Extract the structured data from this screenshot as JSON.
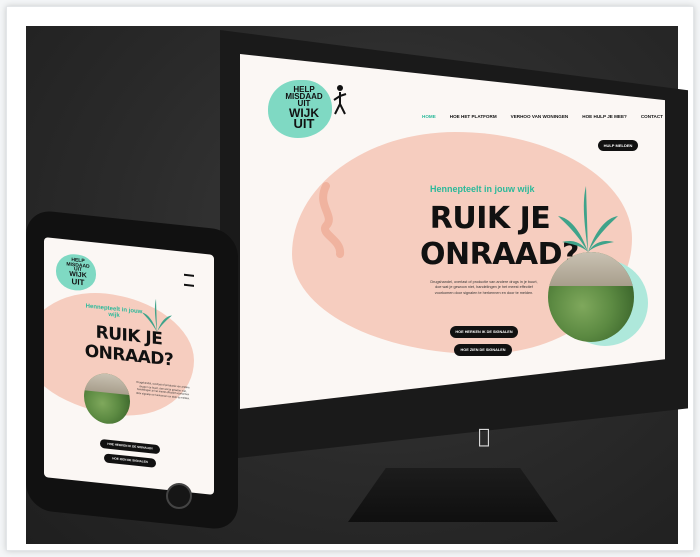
{
  "site": {
    "logo_lines": [
      "HELP",
      "MISDAAD",
      "UIT",
      "WIJK",
      "UIT"
    ],
    "nav": [
      "Home",
      "Hoe het platform",
      "Verhoo van woningen",
      "Hoe hulp je mee?",
      "Contact"
    ],
    "nav_button": "Hulp melden",
    "eyebrow": "Hennepteelt in jouw wijk",
    "headline_1": "RUIK JE",
    "headline_2": "ONRAAD?",
    "body": "Drugshandel, overlast of productie van andere drugs in je buurt, doe wat je gewoon niet, handelingen je het meest effectief voorkomen door signalen te herkennen en door te melden.",
    "button_primary": "Hoe herken ik de signalen",
    "button_secondary": "Hoe zien de signalen",
    "colors": {
      "teal": "#7fd9c3",
      "accent": "#2bb99a",
      "peach": "#f6cdbf",
      "dark": "#111111"
    }
  },
  "icons": {
    "apple": "apple-logo-icon",
    "leaf": "cannabis-leaf-icon"
  }
}
